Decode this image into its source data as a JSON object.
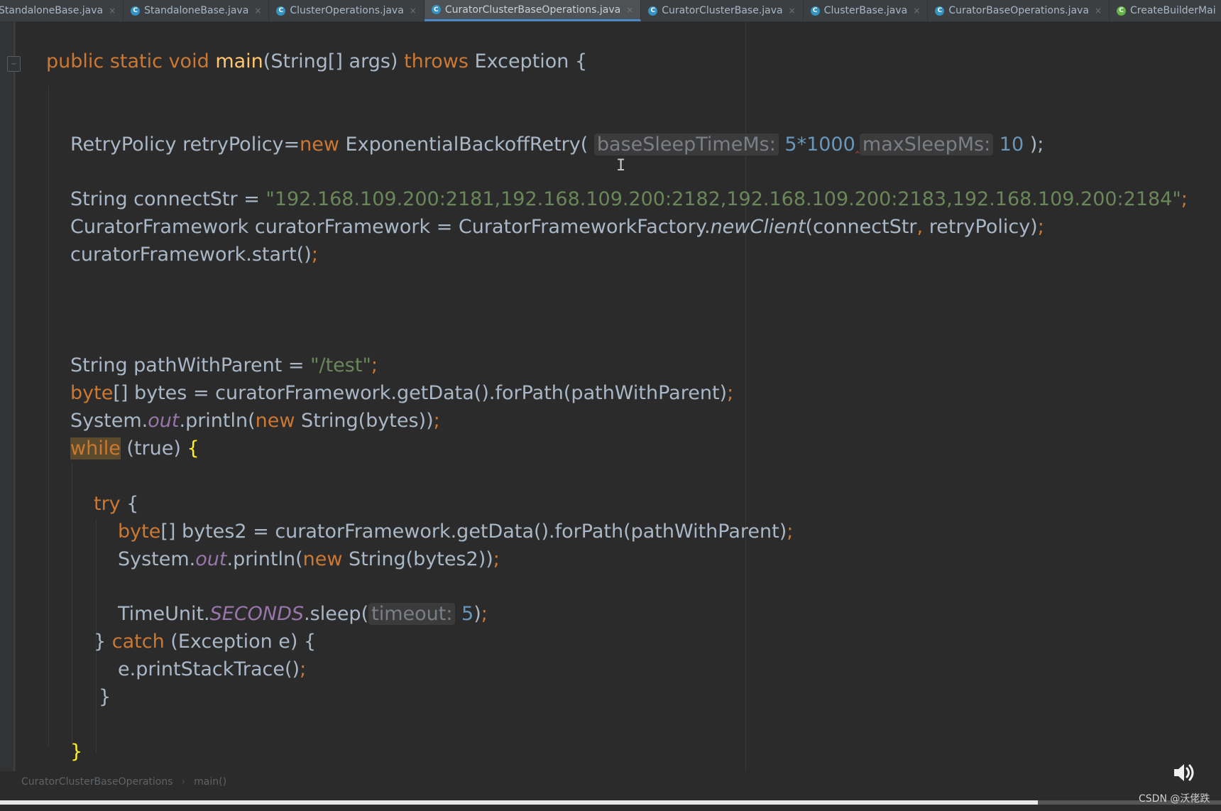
{
  "tabs": [
    {
      "label": "StandaloneBase.java",
      "icon": "class-icon",
      "active": false
    },
    {
      "label": "StandaloneBase.java",
      "icon": "class-icon",
      "active": false
    },
    {
      "label": "ClusterOperations.java",
      "icon": "class-icon",
      "active": false
    },
    {
      "label": "CuratorClusterBaseOperations.java",
      "icon": "class-icon",
      "active": true
    },
    {
      "label": "CuratorClusterBase.java",
      "icon": "class-icon",
      "active": false
    },
    {
      "label": "ClusterBase.java",
      "icon": "class-icon",
      "active": false
    },
    {
      "label": "CuratorBaseOperations.java",
      "icon": "class-icon",
      "active": false
    },
    {
      "label": "CreateBuilderMai",
      "icon": "class-icon",
      "active": false
    }
  ],
  "tab_close_glyph": "×",
  "code": {
    "l1_public": "public",
    "l1_static": "static",
    "l1_void": "void",
    "l1_main": "main",
    "l1_sig": "(String[] args)",
    "l1_throws": "throws",
    "l1_rest": "Exception {",
    "l2_a": "RetryPolicy retryPolicy=",
    "l2_new": "new",
    "l2_b": " ExponentialBackoffRetry(",
    "l2_hint1": "baseSleepTimeMs:",
    "l2_val1": "5*1000",
    "l2_hint2": "maxSleepMs:",
    "l2_val2": "10",
    "l2_end": ");",
    "l3_a": "String connectStr = ",
    "l3_str": "\"192.168.109.200:2181,192.168.109.200:2182,192.168.109.200:2183,192.168.109.200:2184\"",
    "l3_end": ";",
    "l4_a": "CuratorFramework curatorFramework = CuratorFrameworkFactory.",
    "l4_it": "newClient",
    "l4_b": "(connectStr",
    "l4_comma": ",",
    "l4_c": " retryPolicy)",
    "l4_end": ";",
    "l5_a": "curatorFramework.start()",
    "l5_end": ";",
    "l6_a": "String pathWithParent = ",
    "l6_str": "\"/test\"",
    "l6_end": ";",
    "l7_kw": "byte",
    "l7_a": "[] bytes = curatorFramework.getData().forPath(pathWithParent)",
    "l7_end": ";",
    "l8_a": "System.",
    "l8_fld": "out",
    "l8_b": ".println(",
    "l8_new": "new",
    "l8_c": " String(bytes))",
    "l8_end": ";",
    "l9_while": "while",
    "l9_a": " (true) ",
    "l9_brace": "{",
    "l10_try": "try",
    "l10_a": " {",
    "l11_kw": "byte",
    "l11_a": "[] bytes2 = curatorFramework.getData().forPath(pathWithParent)",
    "l11_end": ";",
    "l12_a": "System.",
    "l12_fld": "out",
    "l12_b": ".println(",
    "l12_new": "new",
    "l12_c": " String(bytes2))",
    "l12_end": ";",
    "l13_a": "TimeUnit.",
    "l13_fld": "SECONDS",
    "l13_b": ".sleep(",
    "l13_hint": "timeout:",
    "l13_val": "5",
    "l13_c": ")",
    "l13_end": ";",
    "l14_a": "} ",
    "l14_catch": "catch",
    "l14_b": " (Exception e) {",
    "l15_a": "e.printStackTrace()",
    "l15_end": ";",
    "l16_a": "}",
    "l17_a": "}"
  },
  "breadcrumb": {
    "class_name": "CuratorClusterBaseOperations",
    "separator": "›",
    "method_name": "main()"
  },
  "video": {
    "progress_percent": 85,
    "volume_icon": "volume-icon"
  },
  "watermark": "CSDN @沃佬跌",
  "colors": {
    "background": "#2b2b2b",
    "keyword": "#cc7832",
    "string": "#6a8759",
    "number": "#6897bb",
    "field": "#9876aa",
    "method": "#ffc66d",
    "active_tab_underline": "#4a88c7"
  }
}
